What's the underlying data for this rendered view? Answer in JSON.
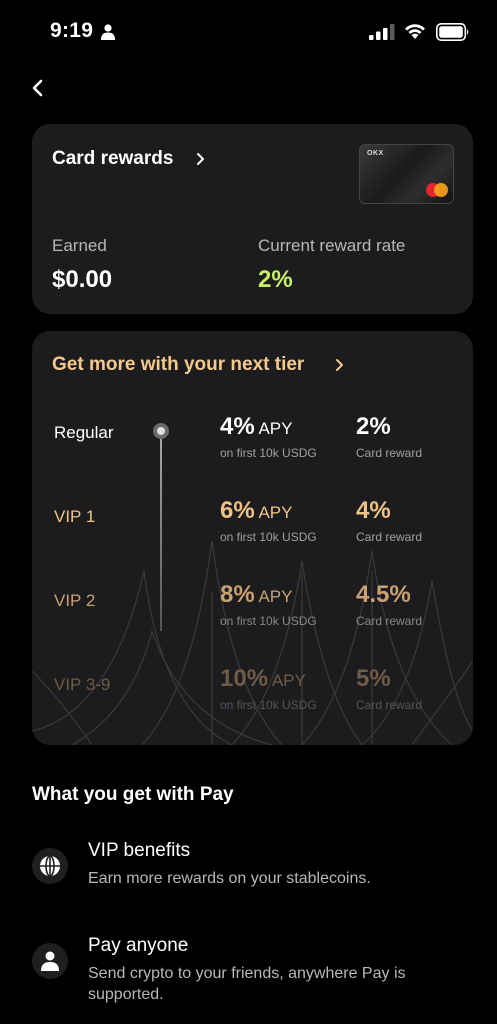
{
  "status_bar": {
    "time": "9:19"
  },
  "card_rewards": {
    "title": "Card rewards",
    "card_brand": "OKX",
    "earned_label": "Earned",
    "earned_value": "$0.00",
    "rate_label": "Current reward rate",
    "rate_value": "2%",
    "rate_color": "#c7f06a"
  },
  "tiers": {
    "title": "Get more with your next tier",
    "title_color": "#f5c98b",
    "rows": [
      {
        "name": "Regular",
        "apy": "4%",
        "apy_unit": " APY",
        "apy_sub": "on first 10k USDG",
        "reward": "2%",
        "reward_sub": "Card reward"
      },
      {
        "name": "VIP 1",
        "apy": "6%",
        "apy_unit": " APY",
        "apy_sub": "on first 10k USDG",
        "reward": "4%",
        "reward_sub": "Card reward"
      },
      {
        "name": "VIP 2",
        "apy": "8%",
        "apy_unit": " APY",
        "apy_sub": "on first 10k USDG",
        "reward": "4.5%",
        "reward_sub": "Card reward"
      },
      {
        "name": "VIP 3-9",
        "apy": "10%",
        "apy_unit": " APY",
        "apy_sub": "on first 10k USDG",
        "reward": "5%",
        "reward_sub": "Card reward"
      }
    ]
  },
  "benefits": {
    "title": "What you get with Pay",
    "items": [
      {
        "icon": "globe-icon",
        "title": "VIP benefits",
        "desc": "Earn more rewards on your stablecoins."
      },
      {
        "icon": "person-icon",
        "title": "Pay anyone",
        "desc": "Send crypto to your friends, anywhere Pay is supported."
      }
    ]
  }
}
